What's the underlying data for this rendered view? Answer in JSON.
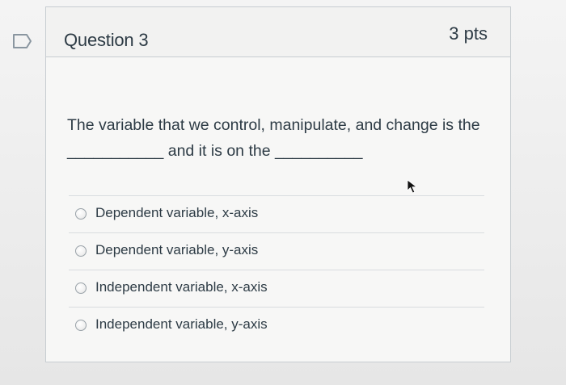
{
  "question": {
    "title": "Question 3",
    "points": "3 pts",
    "text_line1": "The variable that we control, manipulate, and change is the",
    "text_line2_mid": "and it is on the",
    "blank1": "___________",
    "blank2": "__________"
  },
  "answers": [
    {
      "label": "Dependent variable, x-axis",
      "selected": false
    },
    {
      "label": "Dependent variable, y-axis",
      "selected": false
    },
    {
      "label": "Independent variable, x-axis",
      "selected": false
    },
    {
      "label": "Independent variable, y-axis",
      "selected": false
    }
  ],
  "icons": {
    "flag": "flag-question-icon",
    "cursor": "mouse-pointer-icon"
  },
  "colors": {
    "text": "#2d3b45",
    "border": "#c7cdd1",
    "card_bg": "#f7f7f6"
  }
}
